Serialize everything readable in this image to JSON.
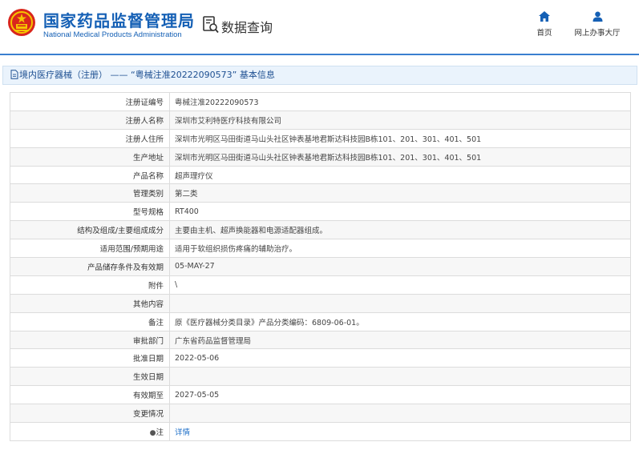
{
  "header": {
    "brand_cn": "国家药品监督管理局",
    "brand_en": "National Medical Products Administration",
    "query_title": "数据查询",
    "nav": {
      "home": "首页",
      "service_hall": "网上办事大厅"
    },
    "colors": {
      "brand_blue": "#1560b5",
      "accent_line": "#3a7fd0",
      "emblem_red": "#d9261c",
      "emblem_gold": "#f5c400"
    }
  },
  "section_title": "境内医疗器械（注册） —— “粤械注准20222090573” 基本信息",
  "rows": [
    {
      "label": "注册证编号",
      "value": "粤械注准20222090573"
    },
    {
      "label": "注册人名称",
      "value": "深圳市艾利特医疗科技有限公司"
    },
    {
      "label": "注册人住所",
      "value": "深圳市光明区马田街道马山头社区钟表基地君斯达科技园B栋101、201、301、401、501"
    },
    {
      "label": "生产地址",
      "value": "深圳市光明区马田街道马山头社区钟表基地君斯达科技园B栋101、201、301、401、501"
    },
    {
      "label": "产品名称",
      "value": "超声理疗仪"
    },
    {
      "label": "管理类别",
      "value": "第二类"
    },
    {
      "label": "型号规格",
      "value": "RT400"
    },
    {
      "label": "结构及组成/主要组成成分",
      "value": "主要由主机、超声换能器和电源适配器组成。"
    },
    {
      "label": "适用范围/预期用途",
      "value": "适用于软组织损伤疼痛的辅助治疗。"
    },
    {
      "label": "产品储存条件及有效期",
      "value": "05-MAY-27"
    },
    {
      "label": "附件",
      "value": "\\"
    },
    {
      "label": "其他内容",
      "value": ""
    },
    {
      "label": "备注",
      "value": "原《医疗器械分类目录》产品分类编码：6809-06-01。"
    },
    {
      "label": "审批部门",
      "value": "广东省药品监督管理局"
    },
    {
      "label": "批准日期",
      "value": "2022-05-06"
    },
    {
      "label": "生效日期",
      "value": ""
    },
    {
      "label": "有效期至",
      "value": "2027-05-05"
    },
    {
      "label": "变更情况",
      "value": ""
    }
  ],
  "note_row": {
    "label": "注",
    "pin": "●",
    "link": "详情"
  }
}
